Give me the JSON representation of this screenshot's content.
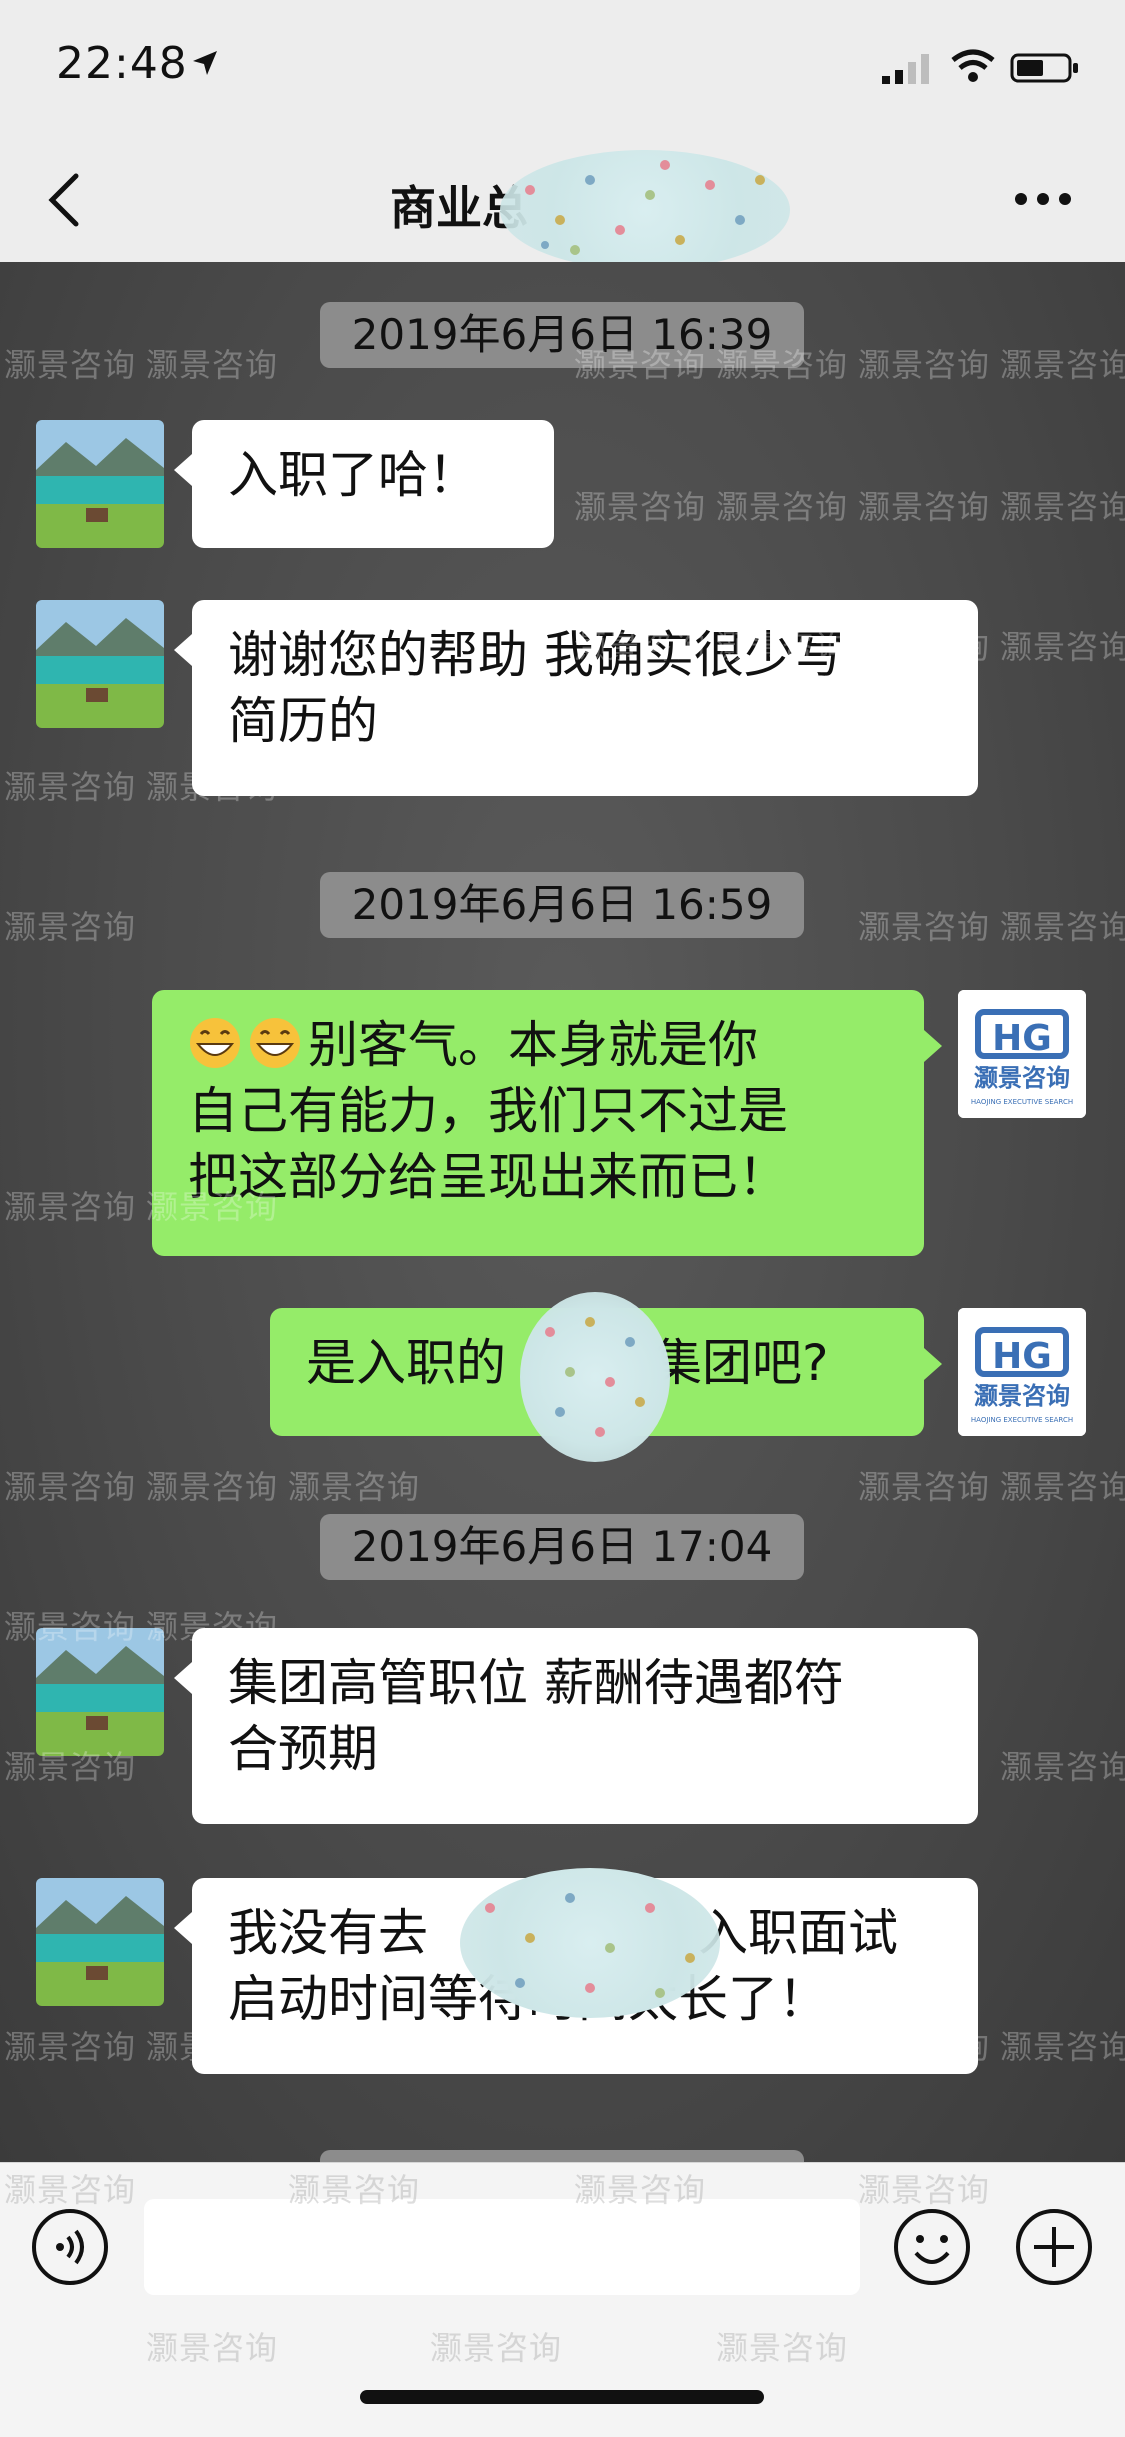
{
  "status_bar": {
    "time": "22:48"
  },
  "nav": {
    "title": "商业总"
  },
  "messages": [
    {
      "type": "timestamp",
      "text": "2019年6月6日 16:39"
    },
    {
      "type": "incoming",
      "text": "入职了哈！"
    },
    {
      "type": "incoming",
      "text": "谢谢您的帮助 我确实很少写简历的"
    },
    {
      "type": "timestamp",
      "text": "2019年6月6日 16:59"
    },
    {
      "type": "outgoing",
      "emoji": "grinning-face-emoji",
      "text": "别客气。本身就是你自己有能力，我们只不过是把这部分给呈现出来而已！"
    },
    {
      "type": "outgoing",
      "text_before": "是入职的",
      "text_after": "集团吧?"
    },
    {
      "type": "timestamp",
      "text": "2019年6月6日 17:04"
    },
    {
      "type": "incoming",
      "text": "集团高管职位 薪酬待遇都符合预期"
    },
    {
      "type": "incoming",
      "text_before": "我没有去",
      "text_after": "入职面试启动时间等待时间太长了！"
    }
  ],
  "chat_lines": {
    "m2_line1": "谢谢您的帮助 我确实很少写",
    "m2_line2": "简历的",
    "m3_line1": "别客气。本身就是你",
    "m3_line2": "自己有能力，我们只不过是",
    "m3_line3": "把这部分给呈现出来而已！",
    "m5_line1": "集团高管职位 薪酬待遇都符",
    "m5_line2": "合预期",
    "m6_line1_a": "我没有去",
    "m6_line1_b": "入职面试",
    "m6_line2": "启动时间等待时间太长了！"
  },
  "brand_avatar": {
    "logo_text": "HG",
    "name": "灏景咨询",
    "tagline": "HAOJING EXECUTIVE SEARCH"
  },
  "watermark": "灏景咨询",
  "colors": {
    "outgoing_bubble": "#95ec69",
    "incoming_bubble": "#ffffff",
    "timestamp_bg": "#8c8c8c",
    "chat_bg": "#4a4a4a",
    "header_bg": "#ededed",
    "brand_blue": "#3a6fb5"
  }
}
